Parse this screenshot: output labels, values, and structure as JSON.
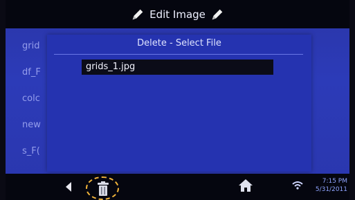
{
  "header": {
    "title": "Edit Image"
  },
  "background_list": {
    "items": [
      "grid",
      "df_F",
      "colc",
      "new",
      "s_F("
    ]
  },
  "dialog": {
    "title": "Delete - Select File",
    "files": [
      "grids_1.jpg"
    ]
  },
  "status": {
    "time": "7:15 PM",
    "date": "5/31/2011"
  },
  "colors": {
    "accent_highlight": "#f0b33a",
    "screen_blue": "#2c3bb8",
    "bar": "#05060f"
  },
  "icons": [
    "pencil-icon",
    "back-arrow-icon",
    "trash-icon",
    "home-icon",
    "wifi-icon"
  ]
}
